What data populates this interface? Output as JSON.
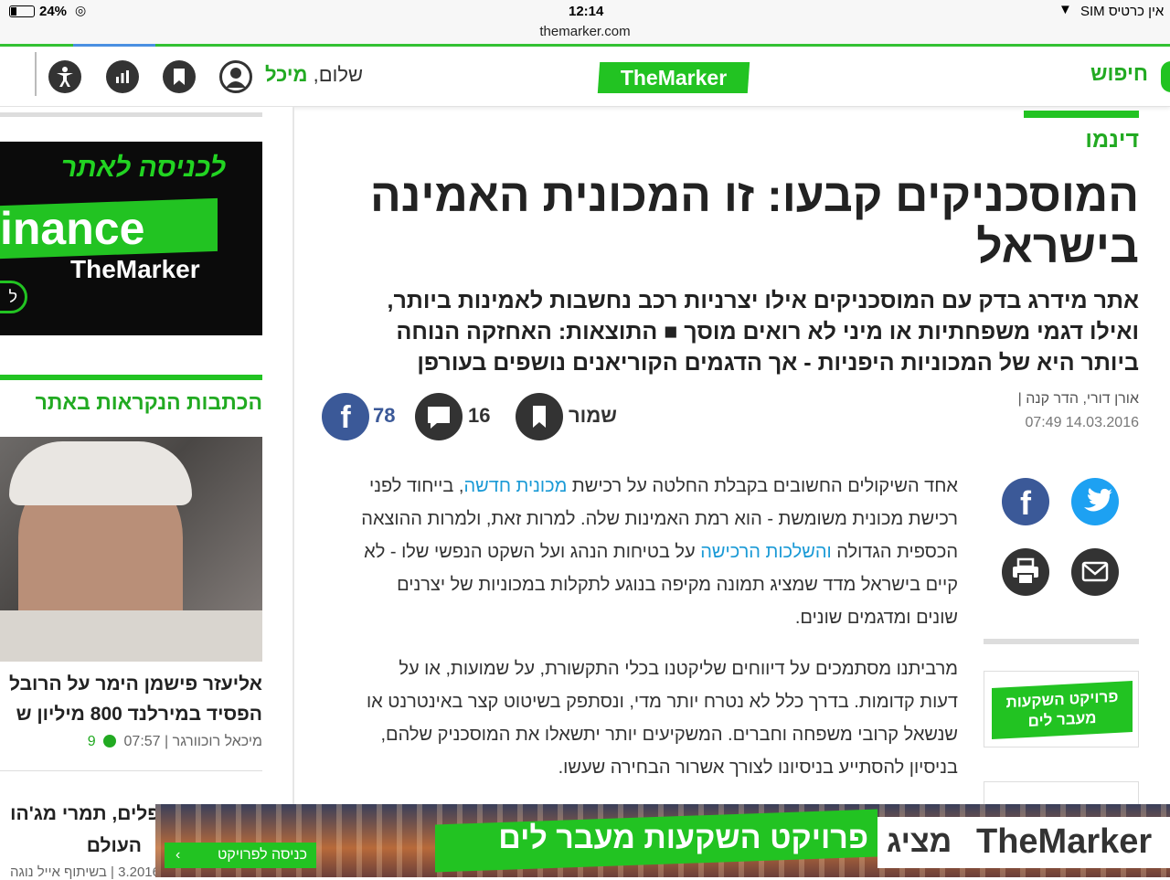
{
  "status_bar": {
    "battery": "24%",
    "time": "12:14",
    "carrier": "אין כרטיס SIM",
    "url": "themarker.com"
  },
  "header": {
    "search_label": "חיפוש",
    "logo_text": "TheMarker",
    "greeting": "שלום,",
    "user_name": "מיכל",
    "icons": [
      "user-icon",
      "bookmark-icon",
      "stats-icon",
      "accessibility-icon"
    ]
  },
  "sidebar": {
    "ad": {
      "top_text": "לכניסה לאתר",
      "brand_text": "inance",
      "sub_brand": "TheMarker",
      "button_glyph": "ל"
    },
    "most_read_title": "הכתבות הנקראות באתר",
    "story1": {
      "title_line1": "אליעזר פישמן הימר על הרובל",
      "title_line2": "הפסיד במירלנד 800 מיליון ש",
      "author": "מיכאל רוכוורגר",
      "time": "07:57",
      "comments": "9"
    },
    "story2": {
      "title_line1": "פלים, תמרי מג'הו",
      "title_line2": "העולם",
      "meta": "3.2016 | בשיתוף אייל נוגה"
    }
  },
  "article": {
    "section": "דינמו",
    "title_line1": "המוסכניקים קבעו: זו המכונית האמינה",
    "title_line2": "בישראל",
    "subtitle_line1": "אתר מידרג בדק עם המוסכניקים אילו יצרניות רכב נחשבות לאמינות ביותר,",
    "subtitle_line2": "ואילו דגמי משפחתיות או מיני לא רואים מוסך ■ התוצאות: האחזקה הנוחה",
    "subtitle_line3": "ביותר היא של המכוניות היפניות - אך הדגמים הקוריאנים נושפים בעורפן",
    "authors": "אורן דורי, הדר קנה",
    "date": "07:49 14.03.2016",
    "save_label": "שמור",
    "comments_count": "16",
    "facebook_count": "78",
    "para1": {
      "l1a": "אחד השיקולים החשובים בקבלת החלטה על רכישת ",
      "l1link": "מכונית חדשה",
      "l1b": ", בייחוד לפני",
      "l2": "רכישת מכונית משומשת - הוא רמת האמינות שלה. למרות זאת, ולמרות ההוצאה",
      "l3a": "הכספית הגדולה ",
      "l3link": "והשלכות הרכישה",
      "l3b": " על בטיחות הנהג ועל השקט הנפשי שלו - לא",
      "l4": "קיים בישראל מדד שמציג תמונה מקיפה בנוגע לתקלות במכוניות של יצרנים",
      "l5": "שונים ומדגמים שונים."
    },
    "para2": {
      "l1": "מרביתנו מסתמכים על דיווחים שליקטנו בכלי התקשורת, על שמועות, או על",
      "l2": "דעות קדומות. בדרך כלל לא נטרח יותר מדי, ונסתפק בשיטוט קצר באינטרנט או",
      "l3": "שנשאל קרובי משפחה וחברים. המשקיעים יותר יתשאלו את המוסכניק שלהם,",
      "l4": "בניסיון להסתייע בניסיונו לצורך אשרור הבחירה שעשו."
    },
    "promo_box": "פרויקט השקעות מעבר לים"
  },
  "bottom_banner": {
    "brand": "TheMarker",
    "presents": "מציג",
    "headline": "פרויקט השקעות מעבר לים",
    "cta": "כניסה לפרויקט"
  },
  "colors": {
    "brand_green": "#22c322",
    "link_blue": "#1a9ad6",
    "facebook": "#3b5998",
    "twitter": "#1da1f2"
  }
}
